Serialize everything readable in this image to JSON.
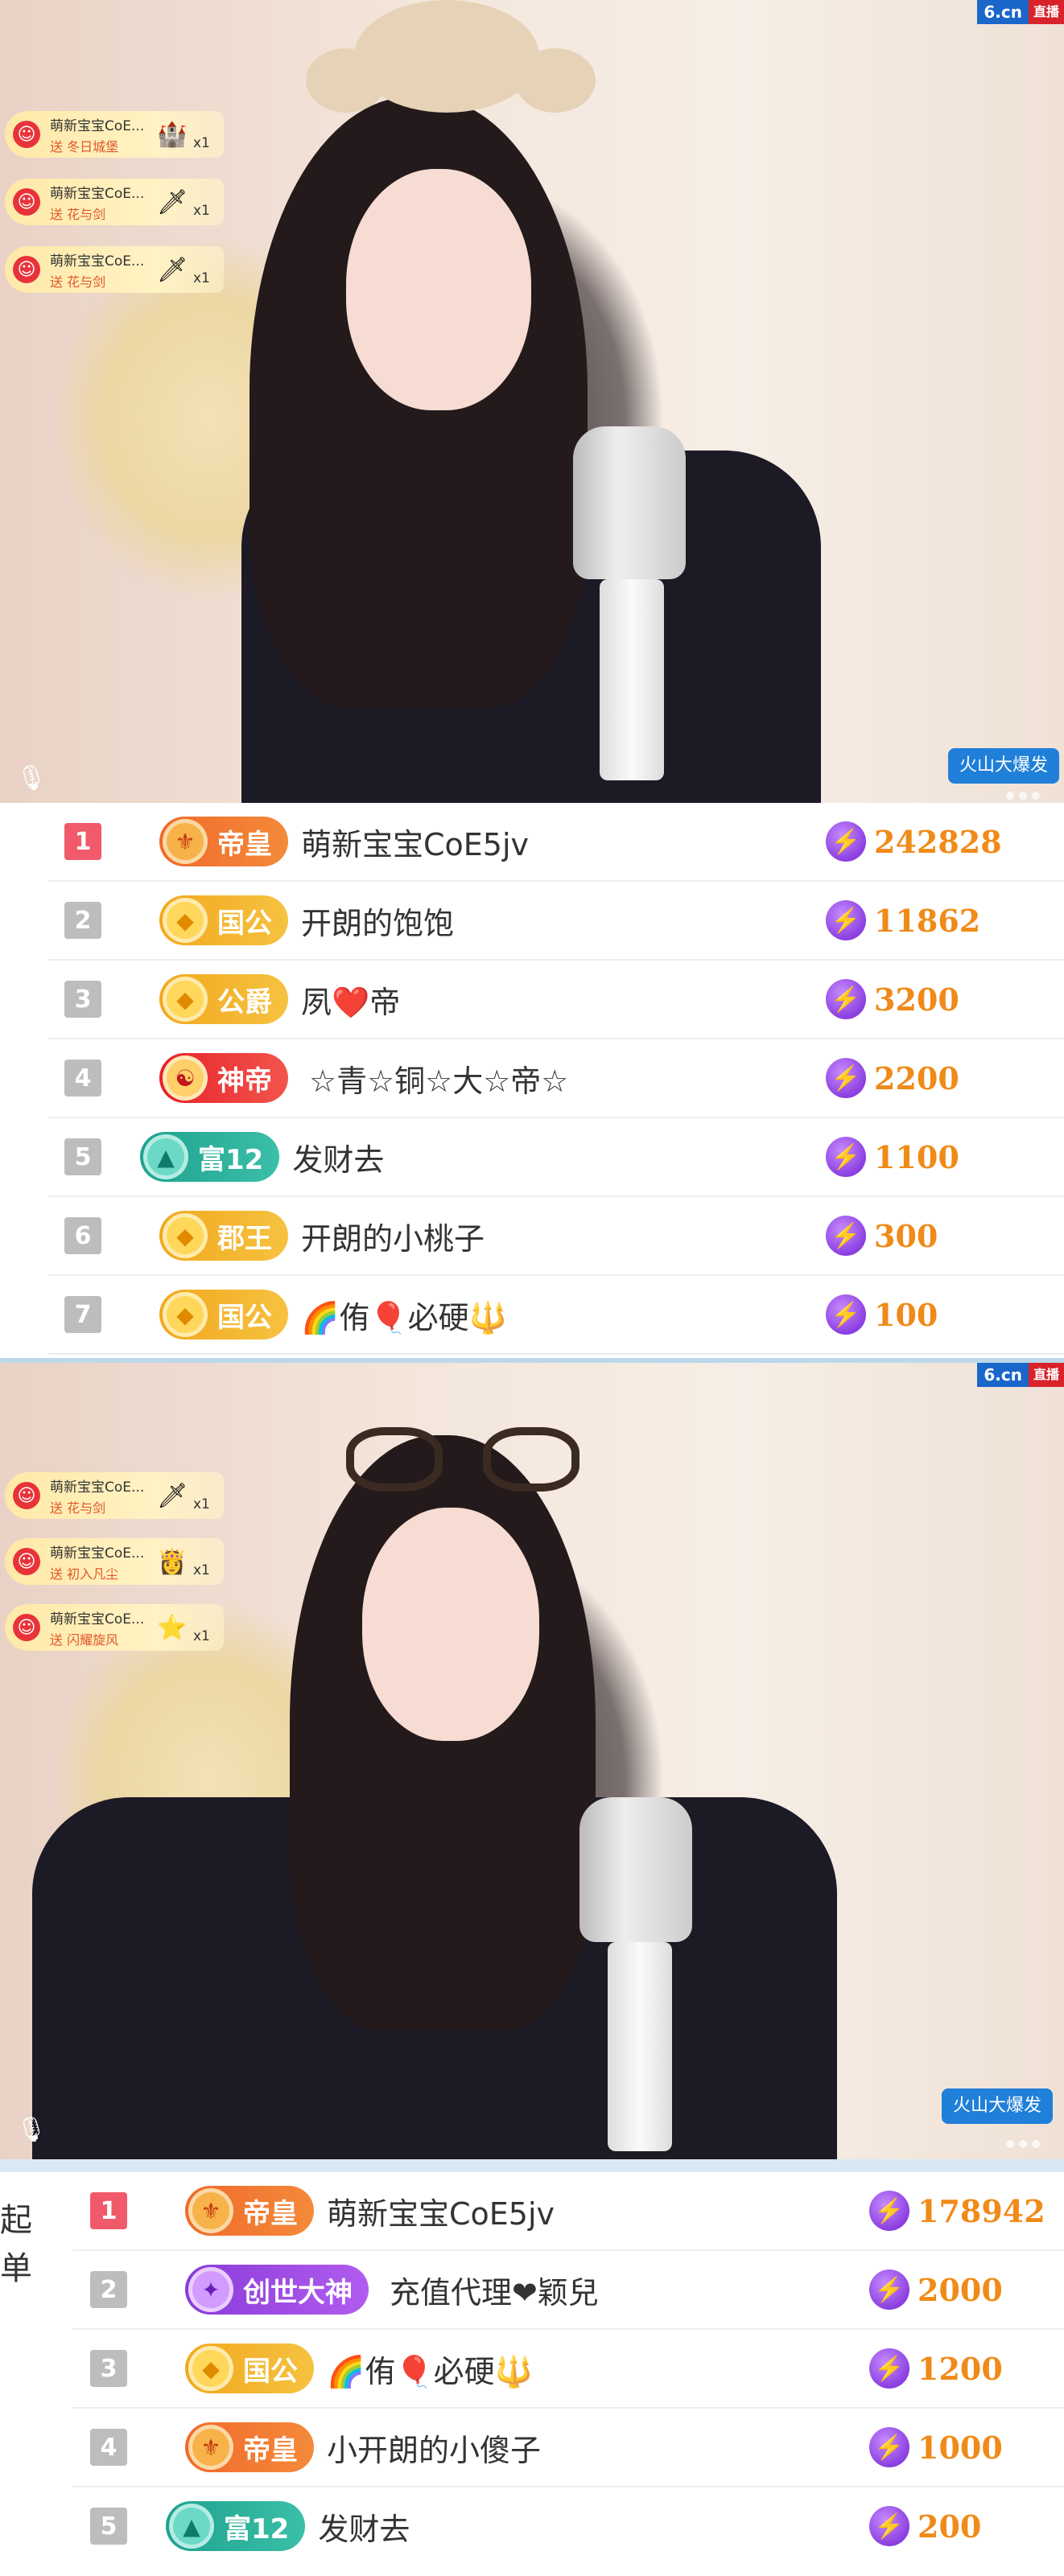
{
  "panel1": {
    "brand": {
      "logo": "6.cn",
      "tag": "直播"
    },
    "gifts": [
      {
        "user": "萌新宝宝CoE...",
        "desc": "送 冬日城堡",
        "icon": "castle-gift-icon",
        "count": "x1"
      },
      {
        "user": "萌新宝宝CoE...",
        "desc": "送 花与剑",
        "icon": "sword-gift-icon",
        "count": "x1"
      },
      {
        "user": "萌新宝宝CoE...",
        "desc": "送 花与剑",
        "icon": "sword-gift-icon",
        "count": "x1"
      }
    ],
    "corner_tag": "火山大爆发",
    "leaderboard": [
      {
        "rank": "1",
        "badge": "帝皇",
        "badge_style": "emperor",
        "name": "萌新宝宝CoE5jv",
        "score": "242828"
      },
      {
        "rank": "2",
        "badge": "国公",
        "badge_style": "gold",
        "name": "开朗的饱饱",
        "score": "11862"
      },
      {
        "rank": "3",
        "badge": "公爵",
        "badge_style": "gold",
        "name": "夙❤️帝",
        "score": "3200"
      },
      {
        "rank": "4",
        "badge": "神帝",
        "badge_style": "shendi",
        "name": "☆青☆铜☆大☆帝☆",
        "score": "2200"
      },
      {
        "rank": "5",
        "badge": "富12",
        "badge_style": "fu",
        "name": "发财去",
        "score": "1100"
      },
      {
        "rank": "6",
        "badge": "郡王",
        "badge_style": "gold",
        "name": "开朗的小桃子",
        "score": "300"
      },
      {
        "rank": "7",
        "badge": "国公",
        "badge_style": "gold",
        "name": "🌈侑🎈必硬🔱",
        "score": "100"
      }
    ]
  },
  "panel2": {
    "brand": {
      "logo": "6.cn",
      "tag": "直播"
    },
    "gifts": [
      {
        "user": "萌新宝宝CoE...",
        "desc": "送 花与剑",
        "icon": "sword-gift-icon",
        "count": "x1"
      },
      {
        "user": "萌新宝宝CoE...",
        "desc": "送 初入凡尘",
        "icon": "fairy-gift-icon",
        "count": "x1"
      },
      {
        "user": "萌新宝宝CoE...",
        "desc": "送 闪耀旋风",
        "icon": "star-gift-icon",
        "count": "x1"
      }
    ],
    "corner_tag": "火山大爆发",
    "side_label": "起单",
    "leaderboard": [
      {
        "rank": "1",
        "badge": "帝皇",
        "badge_style": "emperor",
        "name": "萌新宝宝CoE5jv",
        "score": "178942"
      },
      {
        "rank": "2",
        "badge": "创世大神",
        "badge_style": "chuangshi",
        "name": "充值代理❤颖兒",
        "score": "2000"
      },
      {
        "rank": "3",
        "badge": "国公",
        "badge_style": "gold",
        "name": "🌈侑🎈必硬🔱",
        "score": "1200"
      },
      {
        "rank": "4",
        "badge": "帝皇",
        "badge_style": "emperor",
        "name": "小开朗的小傻子",
        "score": "1000"
      },
      {
        "rank": "5",
        "badge": "富12",
        "badge_style": "fu",
        "name": "发财去",
        "score": "200"
      }
    ]
  },
  "colors": {
    "rank_top": "#f05a6a",
    "rank_normal": "#bdbdbd",
    "score": "#f08a18",
    "brand_blue": "#1a66c9"
  }
}
